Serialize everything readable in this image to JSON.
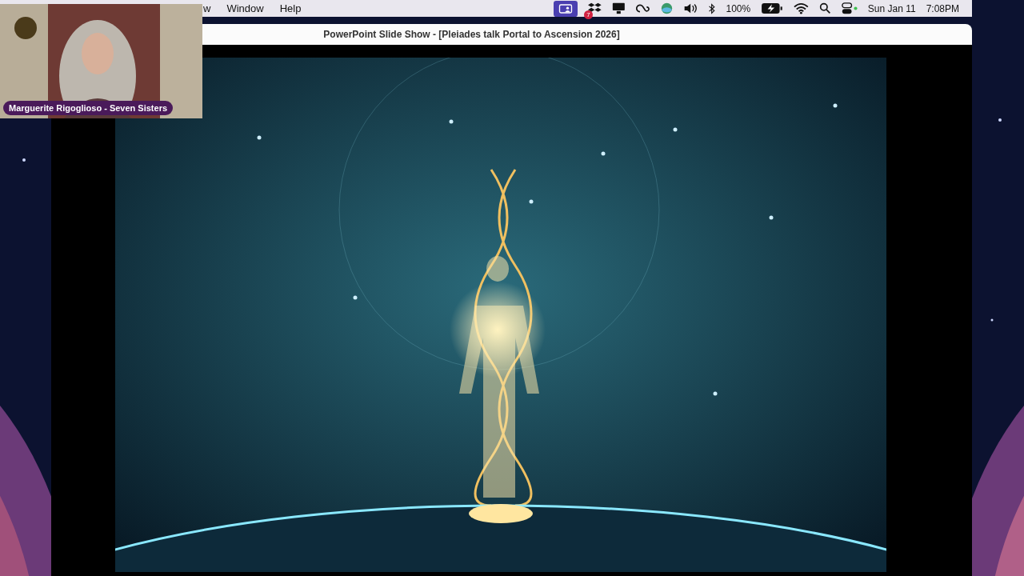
{
  "menu_bar": {
    "menus": [
      {
        "label": "w"
      },
      {
        "label": "Window"
      },
      {
        "label": "Help"
      }
    ],
    "status": {
      "notification_badge": "7",
      "battery": "100%",
      "date": "Sun Jan 11",
      "time": "7:08PM"
    }
  },
  "window": {
    "title": "PowerPoint Slide Show - [Pleiades talk Portal to Ascension 2026]"
  },
  "video_overlay": {
    "kind": "picture",
    "caption": "Marguerite Rigoglioso - Seven Sisters"
  }
}
